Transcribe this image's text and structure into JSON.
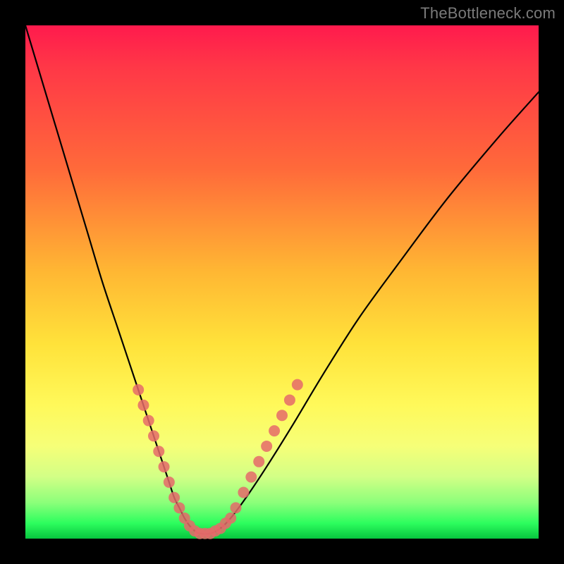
{
  "watermark": "TheBottleneck.com",
  "chart_data": {
    "type": "line",
    "title": "",
    "xlabel": "",
    "ylabel": "",
    "xlim": [
      0,
      100
    ],
    "ylim": [
      0,
      100
    ],
    "series": [
      {
        "name": "bottleneck-curve",
        "x": [
          0,
          3,
          6,
          9,
          12,
          15,
          18,
          20,
          22,
          24,
          25,
          26,
          27,
          28,
          29,
          30,
          31,
          32,
          33,
          34,
          36,
          38,
          40,
          43,
          47,
          52,
          58,
          65,
          73,
          82,
          92,
          100
        ],
        "y": [
          100,
          90,
          80,
          70,
          60,
          50,
          41,
          35,
          29,
          23,
          20,
          17,
          14,
          11,
          8,
          6,
          4,
          2.5,
          1.5,
          1,
          1,
          2,
          4,
          8,
          14,
          22,
          32,
          43,
          54,
          66,
          78,
          87
        ]
      }
    ],
    "markers": {
      "name": "highlight-dots",
      "color": "#e56a6a",
      "radius_px": 8,
      "points": [
        {
          "x": 22,
          "y": 29
        },
        {
          "x": 23,
          "y": 26
        },
        {
          "x": 24,
          "y": 23
        },
        {
          "x": 25,
          "y": 20
        },
        {
          "x": 26,
          "y": 17
        },
        {
          "x": 27,
          "y": 14
        },
        {
          "x": 28,
          "y": 11
        },
        {
          "x": 29,
          "y": 8
        },
        {
          "x": 30,
          "y": 6
        },
        {
          "x": 31,
          "y": 4
        },
        {
          "x": 32,
          "y": 2.5
        },
        {
          "x": 33,
          "y": 1.5
        },
        {
          "x": 34,
          "y": 1
        },
        {
          "x": 35,
          "y": 1
        },
        {
          "x": 36,
          "y": 1
        },
        {
          "x": 37,
          "y": 1.5
        },
        {
          "x": 38,
          "y": 2
        },
        {
          "x": 39,
          "y": 3
        },
        {
          "x": 40,
          "y": 4
        },
        {
          "x": 41,
          "y": 6
        },
        {
          "x": 42.5,
          "y": 9
        },
        {
          "x": 44,
          "y": 12
        },
        {
          "x": 45.5,
          "y": 15
        },
        {
          "x": 47,
          "y": 18
        },
        {
          "x": 48.5,
          "y": 21
        },
        {
          "x": 50,
          "y": 24
        },
        {
          "x": 51.5,
          "y": 27
        },
        {
          "x": 53,
          "y": 30
        }
      ]
    }
  }
}
